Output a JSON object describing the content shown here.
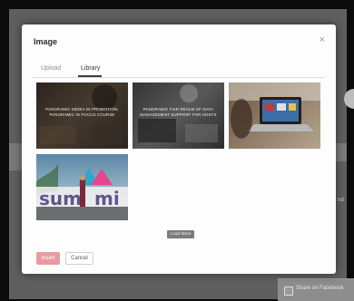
{
  "background": {
    "footer_checkbox_label": "Share on Facebook",
    "side_text": "nd"
  },
  "modal": {
    "title": "Image",
    "close_glyph": "×",
    "tabs": [
      {
        "label": "Upload",
        "active": false
      },
      {
        "label": "Library",
        "active": true
      }
    ],
    "images": [
      {
        "caption": "PANORAMIC MEDIA IN PROMOTION, PANORAMIC IN FOCUS COURSE"
      },
      {
        "caption": "PANORAMIC FAIR REALM OF DATA MANAGEMENT SUPPORT FOR HOSTS"
      },
      {
        "caption": ""
      },
      {
        "caption": ""
      }
    ],
    "load_more_label": "Load More",
    "insert_label": "Insert",
    "cancel_label": "Cancel"
  },
  "colors": {
    "insert_button": "#e99aa0",
    "tab_underline": "#3d3d3d"
  }
}
